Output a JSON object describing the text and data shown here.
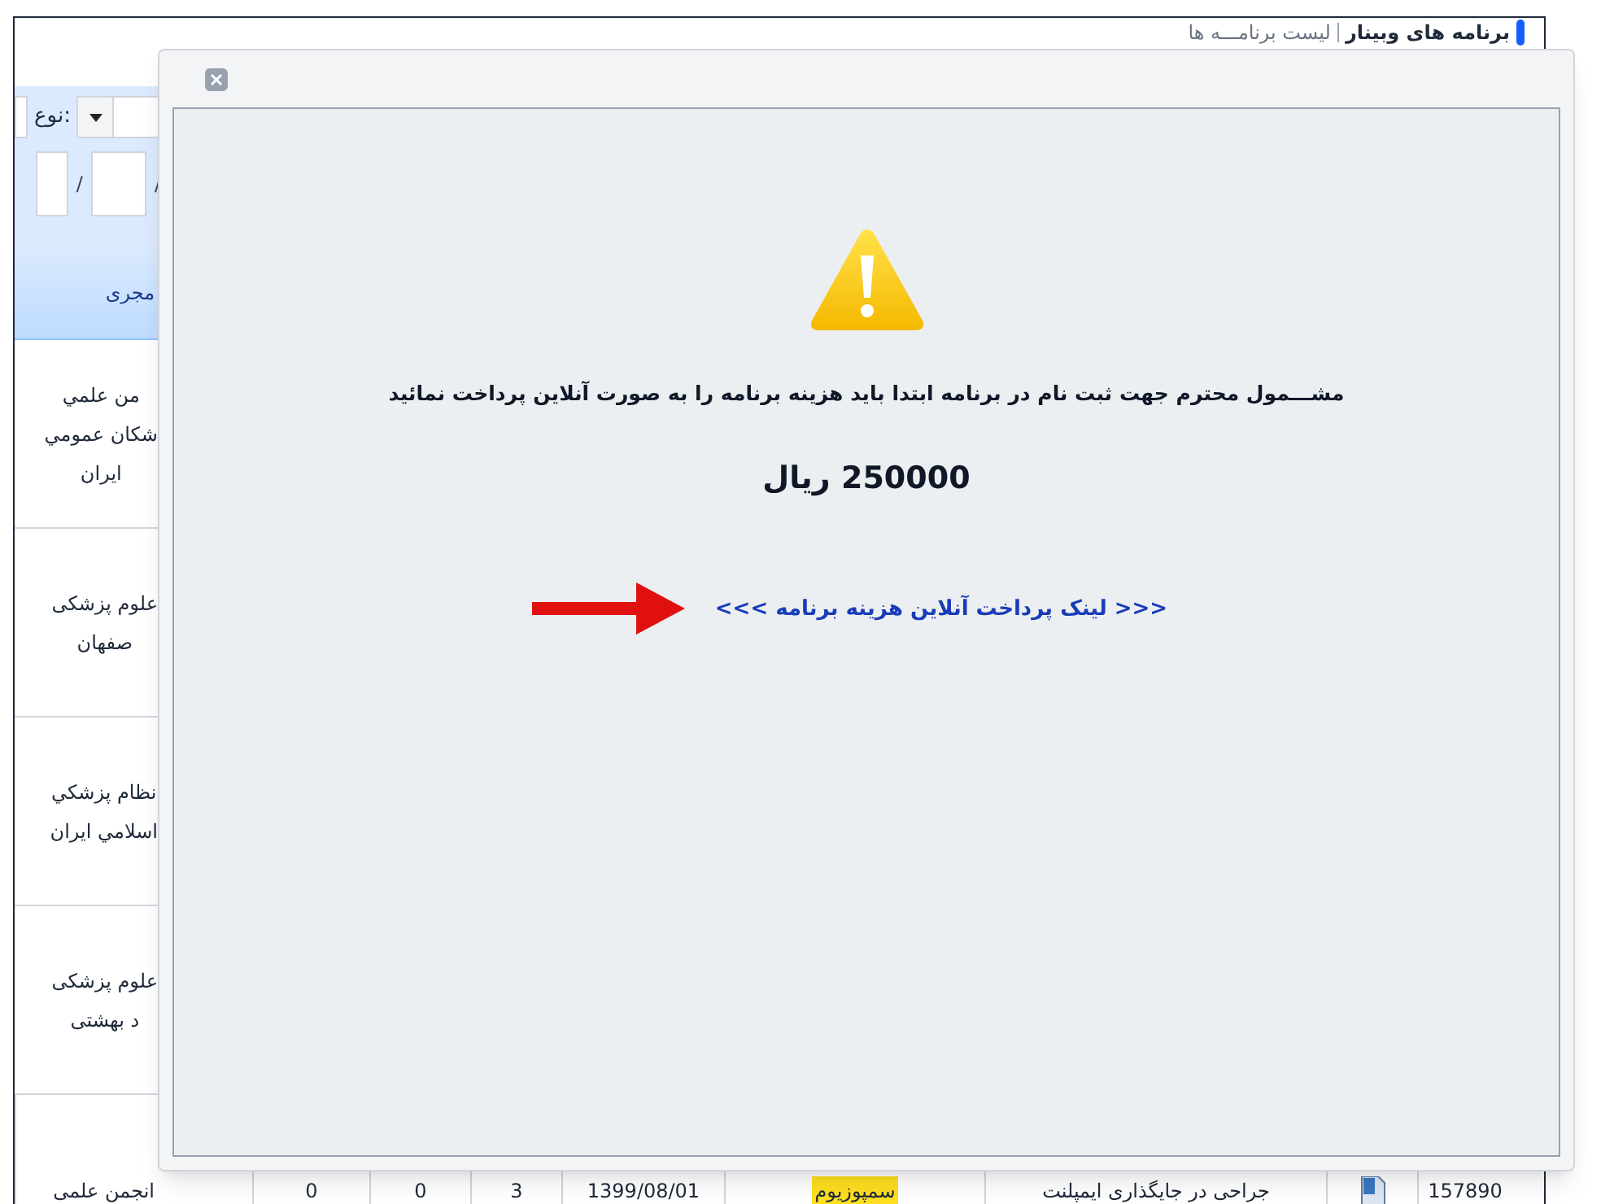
{
  "breadcrumb": {
    "section": "برنامه های وبینار",
    "page": "لیست برنامـــه ها"
  },
  "filters": {
    "type_label": "نوع:",
    "date_separators": [
      "/",
      "/"
    ]
  },
  "table": {
    "columns": [
      {
        "label": "مجری"
      }
    ],
    "organizer_cells": [
      {
        "lines": [
          "من علمي",
          "شكان عمومي",
          "ايران"
        ]
      },
      {
        "lines": [
          "علوم پزشکی",
          "صفهان"
        ]
      },
      {
        "lines": [
          "نظام پزشكي",
          "اسلامي ايران"
        ]
      },
      {
        "lines": [
          "علوم پزشکی",
          "د بهشتی"
        ]
      }
    ],
    "last_row": {
      "id": "157890",
      "title": "جراحی در جایگذاری ایمپلنت",
      "type": {
        "text": "سمپوزیوم",
        "highlighted": true
      },
      "date": "1399/08/01",
      "column_5": "3",
      "column_6": "0",
      "column_7": "0",
      "organizer": "انجمن علمی"
    }
  },
  "dialog": {
    "message": "مشـــمول محترم جهت ثبت نام در برنامه ابتدا باید هزینه برنامه را به صورت آنلاین پرداخت نمائید",
    "amount": "250000 ریال",
    "link": "<<< لینک پرداخت آنلاین هزینه برنامه >>>"
  }
}
